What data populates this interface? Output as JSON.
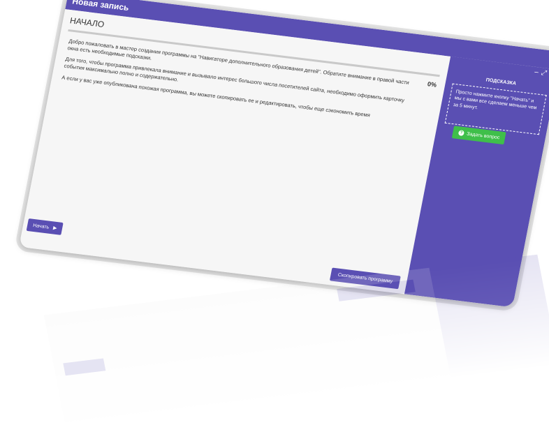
{
  "window": {
    "title": "Новая запись",
    "controls": {
      "minimize": "–",
      "maximize": "⤢",
      "close": "×"
    }
  },
  "main": {
    "step_title": "НАЧАЛО",
    "progress_value": 0,
    "progress_label": "0%",
    "paragraphs": [
      "Добро пожаловать в мастер создания программы на \"Навигаторе дополнительного образования детей\". Обратите внимание в правой части окна есть необходимые подсказки.",
      "Для того, чтобы программа привлекала внимание и вызывало интерес большого числа посетителей сайта, необходимо оформить карточку события максимально полно и содержательно.",
      "А если у вас уже опубликована похожая программа, вы можете скопировать ее и редактировать, чтобы еще сэкономить время"
    ],
    "start_button": "Начать",
    "copy_button": "Скопировать программу"
  },
  "side": {
    "hint_title": "ПОДСКАЗКА",
    "hint_text": "Просто нажмите кнопку \"Начать\" и мы с вами все сделаем меньше чем за 5 минут.",
    "ask_button": "Задать вопрос"
  },
  "colors": {
    "accent": "#5a4fb3",
    "green": "#3fbf4a",
    "panel_bg": "#f6f6f6"
  }
}
